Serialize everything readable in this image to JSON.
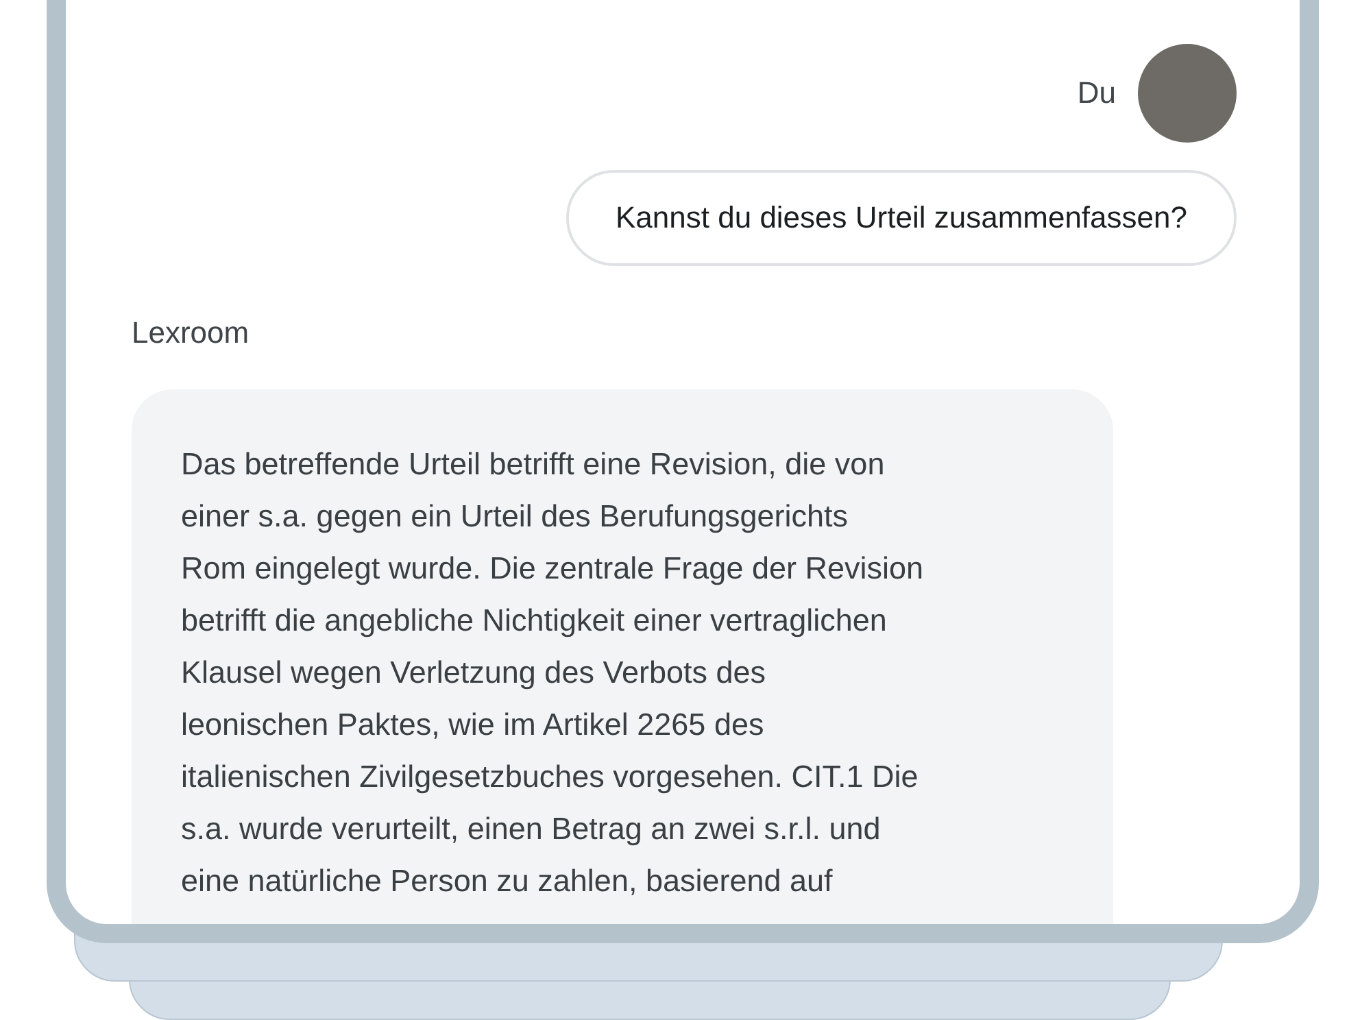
{
  "conversation": [
    {
      "kind": "user",
      "sender": "Du",
      "text": "Kannst du dieses Urteil zusammenfassen?"
    },
    {
      "kind": "assistant",
      "sender": "Lexroom",
      "text": "Das betreffende Urteil betrifft eine Revision, die von\neiner s.a. gegen ein Urteil des Berufungsgerichts\nRom eingelegt wurde. Die zentrale Frage der Revision\nbetrifft die angebliche Nichtigkeit einer vertraglichen\nKlausel wegen Verletzung des Verbots des\nleonischen Paktes, wie im Artikel 2265 des\nitalienischen Zivilgesetzbuches vorgesehen. CIT.1 Die\ns.a. wurde verurteilt, einen Betrag an zwei s.r.l. und\neine natürliche Person zu zahlen, basierend auf"
    }
  ]
}
